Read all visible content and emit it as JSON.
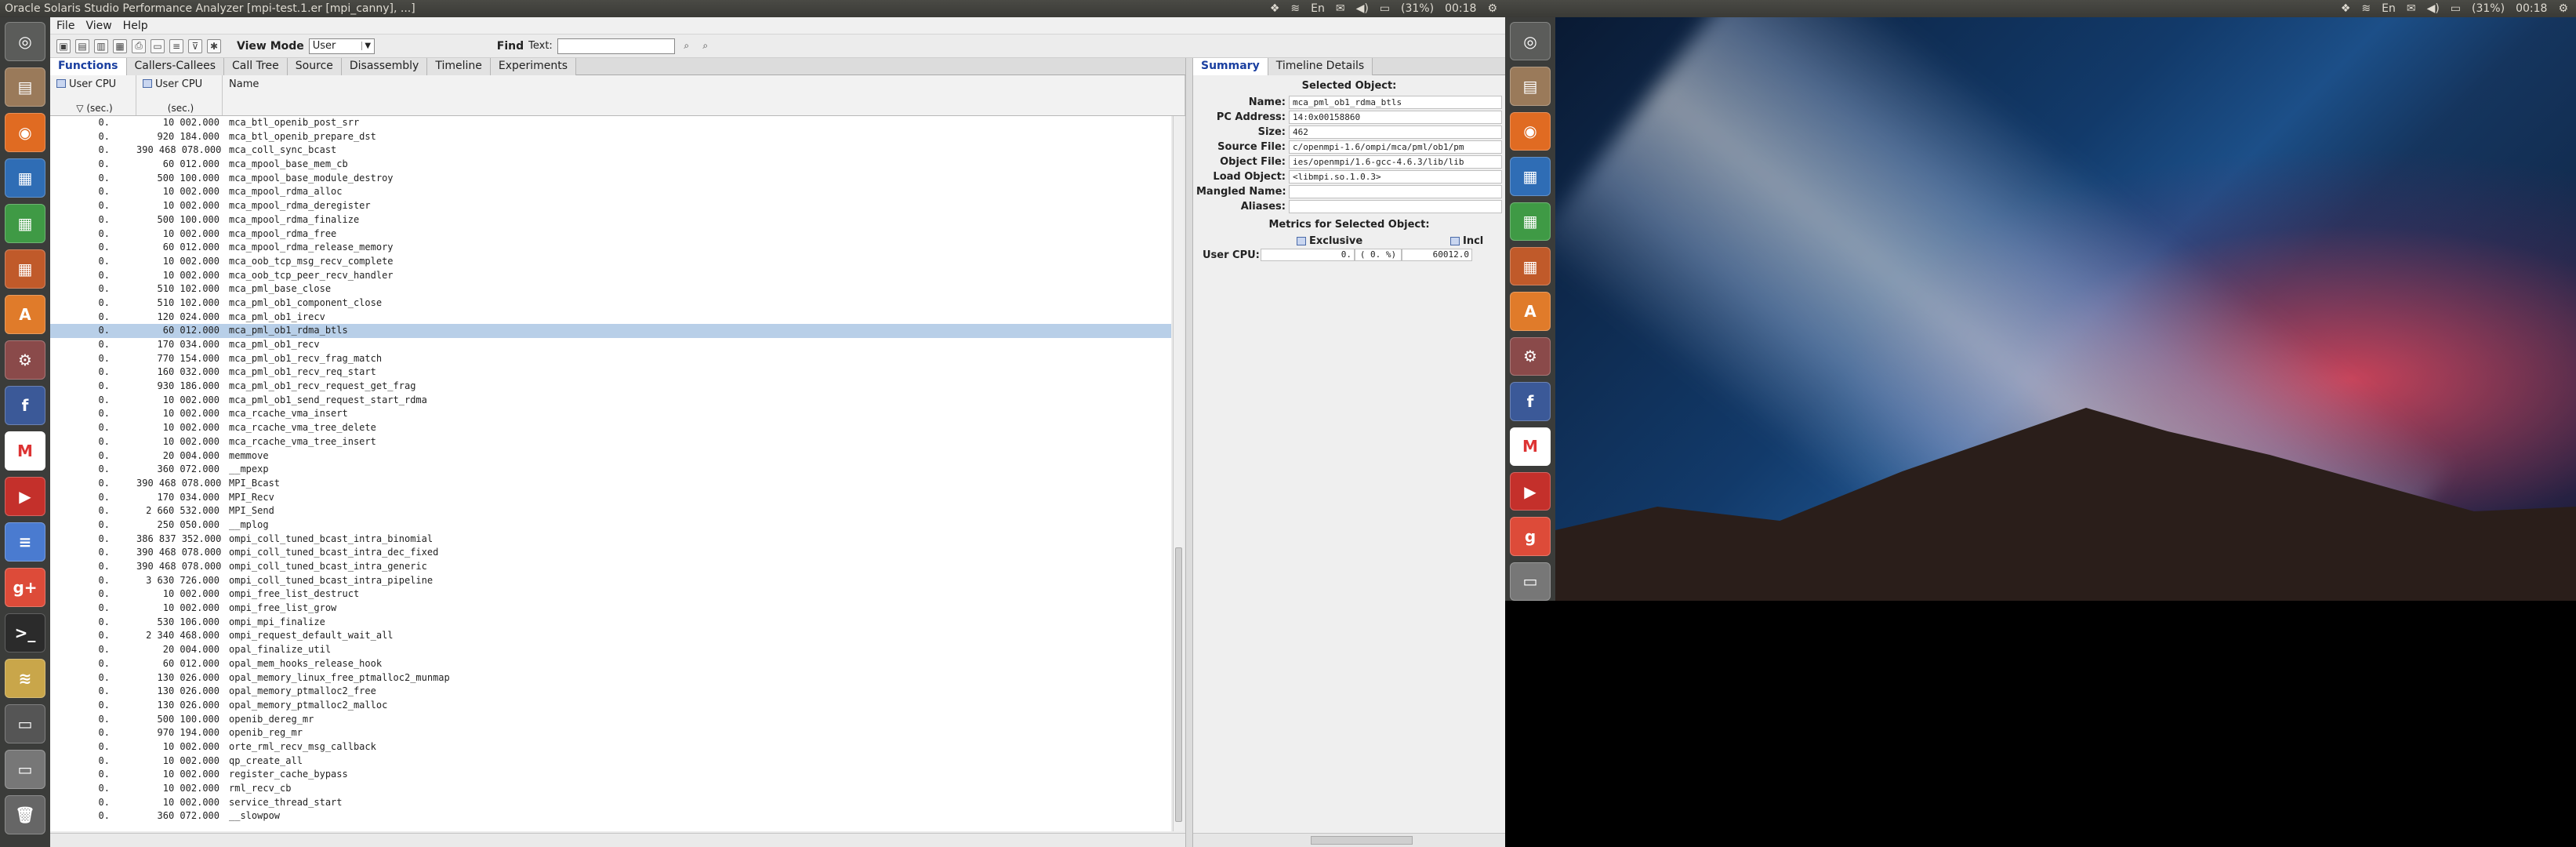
{
  "left_panel": {
    "title": "Oracle Solaris Studio Performance Analyzer [mpi-test.1.er [mpi_canny], ...]",
    "battery": "(31%)",
    "clock": "00:18"
  },
  "right_panel": {
    "battery": "(31%)",
    "clock": "00:18"
  },
  "launcher_left": [
    "dash",
    "files",
    "firefox",
    "writer",
    "calc",
    "impress",
    "software-center",
    "settings",
    "facebook",
    "gmail",
    "youtube",
    "docs",
    "google-plus",
    "terminal",
    "analyzer",
    "drive",
    "scanner",
    "trash"
  ],
  "launcher_right": [
    "dash",
    "files",
    "firefox",
    "writer",
    "calc",
    "impress",
    "software-center",
    "settings",
    "facebook",
    "gmail",
    "youtube",
    "google-drive",
    "scanner"
  ],
  "menu": [
    "File",
    "View",
    "Help"
  ],
  "toolbar": {
    "view_mode_label": "View Mode",
    "view_mode_value": "User",
    "find_label": "Find",
    "text_label": "Text:"
  },
  "tabs": [
    "Functions",
    "Callers-Callees",
    "Call Tree",
    "Source",
    "Disassembly",
    "Timeline",
    "Experiments"
  ],
  "active_tab": "Functions",
  "table": {
    "col1": "User  CPU",
    "col1_sub": "(sec.)",
    "col2": "User  CPU",
    "col2_sub": "(sec.)",
    "col3": "Name",
    "rows": [
      [
        "0.",
        "10 002.000",
        "mca_btl_openib_post_srr"
      ],
      [
        "0.",
        "920 184.000",
        "mca_btl_openib_prepare_dst"
      ],
      [
        "0.",
        "390 468 078.000",
        "mca_coll_sync_bcast"
      ],
      [
        "0.",
        "60 012.000",
        "mca_mpool_base_mem_cb"
      ],
      [
        "0.",
        "500 100.000",
        "mca_mpool_base_module_destroy"
      ],
      [
        "0.",
        "10 002.000",
        "mca_mpool_rdma_alloc"
      ],
      [
        "0.",
        "10 002.000",
        "mca_mpool_rdma_deregister"
      ],
      [
        "0.",
        "500 100.000",
        "mca_mpool_rdma_finalize"
      ],
      [
        "0.",
        "10 002.000",
        "mca_mpool_rdma_free"
      ],
      [
        "0.",
        "60 012.000",
        "mca_mpool_rdma_release_memory"
      ],
      [
        "0.",
        "10 002.000",
        "mca_oob_tcp_msg_recv_complete"
      ],
      [
        "0.",
        "10 002.000",
        "mca_oob_tcp_peer_recv_handler"
      ],
      [
        "0.",
        "510 102.000",
        "mca_pml_base_close"
      ],
      [
        "0.",
        "510 102.000",
        "mca_pml_ob1_component_close"
      ],
      [
        "0.",
        "120 024.000",
        "mca_pml_ob1_irecv"
      ],
      [
        "0.",
        "60 012.000",
        "mca_pml_ob1_rdma_btls"
      ],
      [
        "0.",
        "170 034.000",
        "mca_pml_ob1_recv"
      ],
      [
        "0.",
        "770 154.000",
        "mca_pml_ob1_recv_frag_match"
      ],
      [
        "0.",
        "160 032.000",
        "mca_pml_ob1_recv_req_start"
      ],
      [
        "0.",
        "930 186.000",
        "mca_pml_ob1_recv_request_get_frag"
      ],
      [
        "0.",
        "10 002.000",
        "mca_pml_ob1_send_request_start_rdma"
      ],
      [
        "0.",
        "10 002.000",
        "mca_rcache_vma_insert"
      ],
      [
        "0.",
        "10 002.000",
        "mca_rcache_vma_tree_delete"
      ],
      [
        "0.",
        "10 002.000",
        "mca_rcache_vma_tree_insert"
      ],
      [
        "0.",
        "20 004.000",
        "memmove"
      ],
      [
        "0.",
        "360 072.000",
        "__mpexp"
      ],
      [
        "0.",
        "390 468 078.000",
        "MPI_Bcast"
      ],
      [
        "0.",
        "170 034.000",
        "MPI_Recv"
      ],
      [
        "0.",
        "2 660 532.000",
        "MPI_Send"
      ],
      [
        "0.",
        "250 050.000",
        "__mplog"
      ],
      [
        "0.",
        "386 837 352.000",
        "ompi_coll_tuned_bcast_intra_binomial"
      ],
      [
        "0.",
        "390 468 078.000",
        "ompi_coll_tuned_bcast_intra_dec_fixed"
      ],
      [
        "0.",
        "390 468 078.000",
        "ompi_coll_tuned_bcast_intra_generic"
      ],
      [
        "0.",
        "3 630 726.000",
        "ompi_coll_tuned_bcast_intra_pipeline"
      ],
      [
        "0.",
        "10 002.000",
        "ompi_free_list_destruct"
      ],
      [
        "0.",
        "10 002.000",
        "ompi_free_list_grow"
      ],
      [
        "0.",
        "530 106.000",
        "ompi_mpi_finalize"
      ],
      [
        "0.",
        "2 340 468.000",
        "ompi_request_default_wait_all"
      ],
      [
        "0.",
        "20 004.000",
        "opal_finalize_util"
      ],
      [
        "0.",
        "60 012.000",
        "opal_mem_hooks_release_hook"
      ],
      [
        "0.",
        "130 026.000",
        "opal_memory_linux_free_ptmalloc2_munmap"
      ],
      [
        "0.",
        "130 026.000",
        "opal_memory_ptmalloc2_free"
      ],
      [
        "0.",
        "130 026.000",
        "opal_memory_ptmalloc2_malloc"
      ],
      [
        "0.",
        "500 100.000",
        "openib_dereg_mr"
      ],
      [
        "0.",
        "970 194.000",
        "openib_reg_mr"
      ],
      [
        "0.",
        "10 002.000",
        "orte_rml_recv_msg_callback"
      ],
      [
        "0.",
        "10 002.000",
        "qp_create_all"
      ],
      [
        "0.",
        "10 002.000",
        "register_cache_bypass"
      ],
      [
        "0.",
        "10 002.000",
        "rml_recv_cb"
      ],
      [
        "0.",
        "10 002.000",
        "service_thread_start"
      ],
      [
        "0.",
        "360 072.000",
        "__slowpow"
      ]
    ],
    "selected_row": 15
  },
  "right_tabs": [
    "Summary",
    "Timeline Details"
  ],
  "summary": {
    "heading": "Selected Object:",
    "fields": [
      {
        "label": "Name:",
        "value": "mca_pml_ob1_rdma_btls"
      },
      {
        "label": "PC Address:",
        "value": "14:0x00158860"
      },
      {
        "label": "Size:",
        "value": "462"
      },
      {
        "label": "Source File:",
        "value": "c/openmpi-1.6/ompi/mca/pml/ob1/pm"
      },
      {
        "label": "Object File:",
        "value": "ies/openmpi/1.6-gcc-4.6.3/lib/lib"
      },
      {
        "label": "Load Object:",
        "value": "<libmpi.so.1.0.3>"
      },
      {
        "label": "Mangled Name:",
        "value": ""
      },
      {
        "label": "Aliases:",
        "value": ""
      }
    ],
    "metrics_heading": "Metrics for Selected Object:",
    "exclusive_label": "Exclusive",
    "inclusive_label": "Incl",
    "metric_label": "User CPU:",
    "excl_value": "0.",
    "excl_pct": "(  0.  %)",
    "incl_value": "60012.0"
  }
}
